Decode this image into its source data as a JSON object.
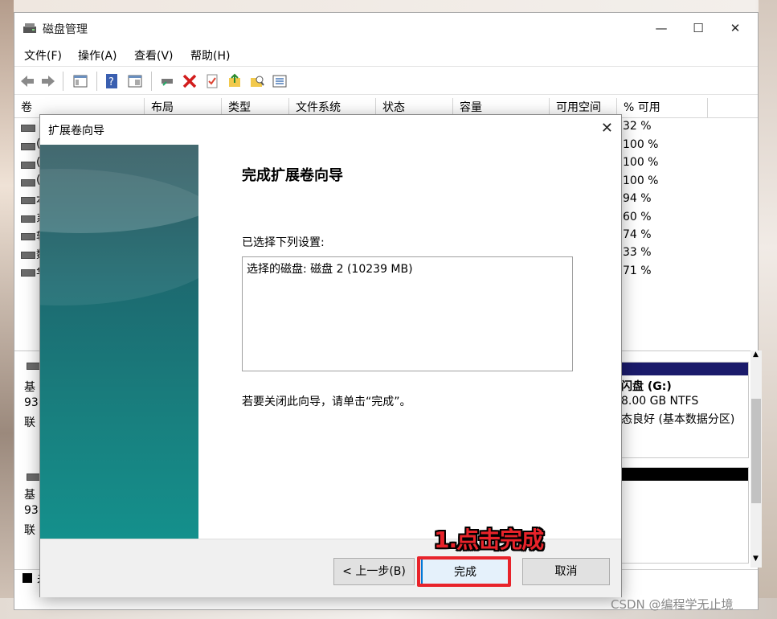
{
  "window": {
    "title": "磁盘管理",
    "controls": [
      "—",
      "☐",
      "✕"
    ]
  },
  "menu": [
    "文件(F)",
    "操作(A)",
    "查看(V)",
    "帮助(H)"
  ],
  "columns": [
    "卷",
    "布局",
    "类型",
    "文件系统",
    "状态",
    "容量",
    "可用空间",
    "% 可用"
  ],
  "volume_rows": [
    {
      "initial": "",
      "pct": "32 %"
    },
    {
      "initial": "(",
      "pct": "100 %"
    },
    {
      "initial": "(",
      "pct": "100 %"
    },
    {
      "initial": "(",
      "pct": "100 %"
    },
    {
      "initial": "本",
      "pct": "94 %"
    },
    {
      "initial": "系",
      "pct": "60 %"
    },
    {
      "initial": "软",
      "pct": "74 %"
    },
    {
      "initial": "数",
      "pct": "33 %"
    },
    {
      "initial": "华",
      "pct": "71 %"
    }
  ],
  "disks": [
    {
      "line1": "基",
      "line2": "93",
      "line3": "联"
    },
    {
      "line1": "基",
      "line2": "93",
      "line3": "联"
    }
  ],
  "volume_panel": {
    "name": "闪盘 (G:)",
    "size": "8.00 GB NTFS",
    "status": "态良好 (基本数据分区)"
  },
  "legend_text": "未",
  "dialog": {
    "title": "扩展卷向导",
    "heading": "完成扩展卷向导",
    "label": "已选择下列设置:",
    "settings": "选择的磁盘: 磁盘 2 (10239 MB)",
    "note": "若要关闭此向导，请单击“完成”。",
    "buttons": {
      "back": "< 上一步(B)",
      "finish": "完成",
      "cancel": "取消"
    }
  },
  "annotation": "1.点击完成",
  "watermark": "CSDN @编程学无止境",
  "colors": {
    "highlight": "#e8232a",
    "volume_bar": "#1b1b6b",
    "wizard_side": "#1d6a70"
  }
}
